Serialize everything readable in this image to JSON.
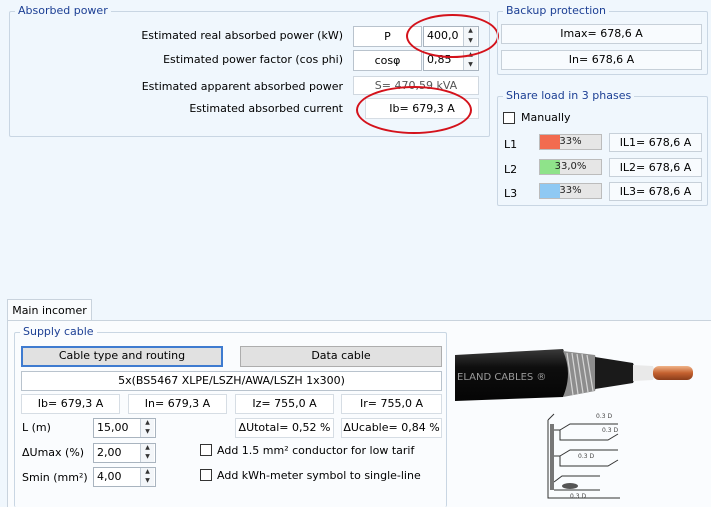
{
  "absorbed": {
    "legend": "Absorbed power",
    "real_power_label": "Estimated real absorbed power (kW)",
    "real_power_symbol": "P",
    "real_power_value": "400,0",
    "pf_label": "Estimated power factor (cos phi)",
    "pf_symbol": "cosφ",
    "pf_value": "0,85",
    "apparent_label": "Estimated apparent absorbed power",
    "apparent_value": "S= 470,59 kVA",
    "current_label": "Estimated absorbed current",
    "current_value": "Ib= 679,3 A"
  },
  "backup": {
    "legend": "Backup protection",
    "imax": "Imax= 678,6 A",
    "in": "In= 678,6 A"
  },
  "share": {
    "legend": "Share load in 3 phases",
    "manually_label": "Manually",
    "phases": [
      {
        "name": "L1",
        "percent": "33%",
        "fraction": 0.33,
        "color": "#f26b4f",
        "current": "IL1= 678,6 A"
      },
      {
        "name": "L2",
        "percent": "33,0%",
        "fraction": 0.33,
        "color": "#8fe38a",
        "current": "IL2= 678,6 A"
      },
      {
        "name": "L3",
        "percent": "33%",
        "fraction": 0.33,
        "color": "#8fc9f3",
        "current": "IL3= 678,6 A"
      }
    ]
  },
  "tab": {
    "label": "Main incomer"
  },
  "supply": {
    "legend": "Supply cable",
    "btn_type": "Cable type and routing",
    "btn_data": "Data cable",
    "cable_desc": "5x(BS5467 XLPE/LSZH/AWA/LSZH 1x300)",
    "ib": "Ib= 679,3 A",
    "in": "In= 679,3 A",
    "iz": "Iz= 755,0 A",
    "ir": "Ir= 755,0 A",
    "l_label": "L (m)",
    "l_value": "15,00",
    "du_label": "ΔUmax (%)",
    "du_value": "2,00",
    "smin_label": "Smin (mm²)",
    "smin_value": "4,00",
    "du_total": "ΔUtotal= 0,52 %",
    "du_cable": "ΔUcable= 0,84 %",
    "add_conductor": "Add 1.5 mm² conductor for low tarif",
    "add_kwh": "Add kWh-meter symbol to single-line",
    "cable_brand": "ELAND CABLES ®"
  },
  "colors": {
    "accent": "#1c3f94",
    "highlight_ring": "#d4121b"
  }
}
